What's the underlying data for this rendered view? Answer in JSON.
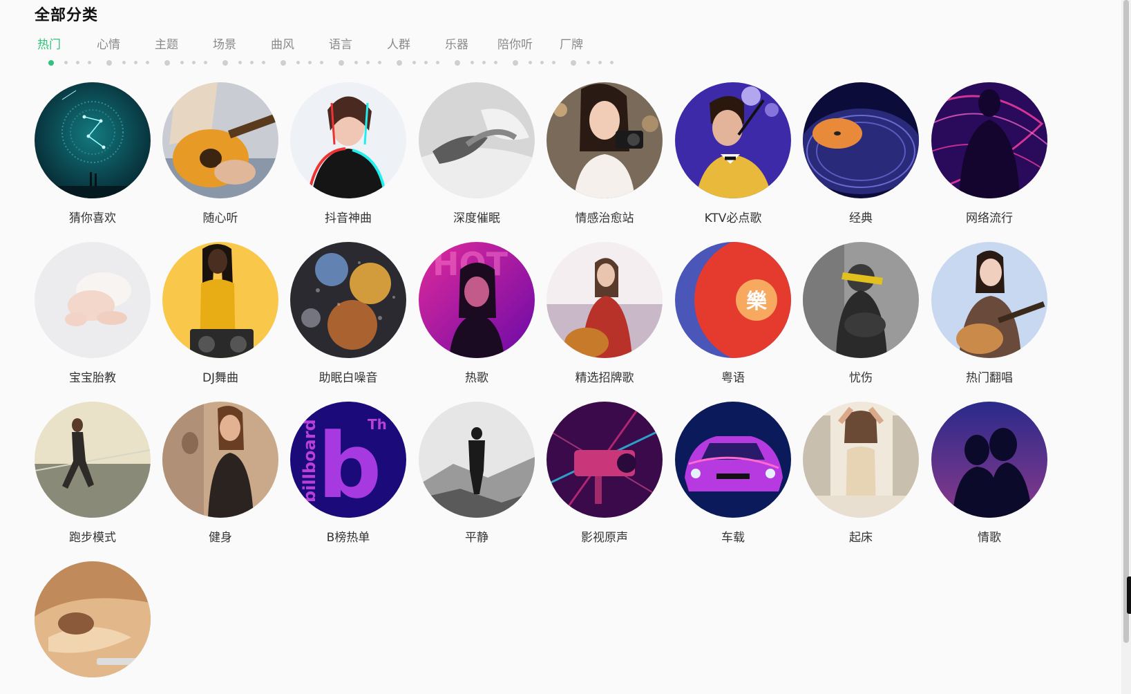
{
  "header": {
    "title": "全部分类"
  },
  "tabs": [
    {
      "label": "热门",
      "active": true
    },
    {
      "label": "心情"
    },
    {
      "label": "主题"
    },
    {
      "label": "场景"
    },
    {
      "label": "曲风"
    },
    {
      "label": "语言"
    },
    {
      "label": "人群"
    },
    {
      "label": "乐器"
    },
    {
      "label": "陪你听"
    },
    {
      "label": "厂牌"
    }
  ],
  "categories": [
    {
      "label": "猜你喜欢",
      "icon": "constellation-image"
    },
    {
      "label": "随心听",
      "icon": "guitar-player-image"
    },
    {
      "label": "抖音神曲",
      "icon": "glitch-woman-image"
    },
    {
      "label": "深度催眠",
      "icon": "sleeping-person-image"
    },
    {
      "label": "情感治愈站",
      "icon": "woman-camera-image"
    },
    {
      "label": "KTV必点歌",
      "icon": "singer-microphone-image"
    },
    {
      "label": "经典",
      "icon": "vinyl-record-image"
    },
    {
      "label": "网络流行",
      "icon": "neon-silhouette-image"
    },
    {
      "label": "宝宝胎教",
      "icon": "baby-image"
    },
    {
      "label": "DJ舞曲",
      "icon": "dj-man-image"
    },
    {
      "label": "助眠白噪音",
      "icon": "rain-bokeh-image"
    },
    {
      "label": "热歌",
      "icon": "hot-neon-woman-image"
    },
    {
      "label": "精选招牌歌",
      "icon": "woman-guitar-sunset-image"
    },
    {
      "label": "粤语",
      "icon": "cantonese-logo-image",
      "badge": "樂"
    },
    {
      "label": "忧伤",
      "icon": "sad-person-image"
    },
    {
      "label": "热门翻唱",
      "icon": "girl-guitar-image"
    },
    {
      "label": "跑步模式",
      "icon": "runner-image"
    },
    {
      "label": "健身",
      "icon": "fitness-woman-image"
    },
    {
      "label": "B榜热单",
      "icon": "billboard-logo-image",
      "logo_text": "billboard",
      "logo_letter": "b",
      "logo_sup": "Th"
    },
    {
      "label": "平静",
      "icon": "man-mountain-image"
    },
    {
      "label": "影视原声",
      "icon": "neon-camera-image"
    },
    {
      "label": "车载",
      "icon": "neon-car-image"
    },
    {
      "label": "起床",
      "icon": "woman-waking-image"
    },
    {
      "label": "情歌",
      "icon": "couple-silhouette-image"
    },
    {
      "label": "",
      "icon": "sleeping-bed-image"
    }
  ]
}
